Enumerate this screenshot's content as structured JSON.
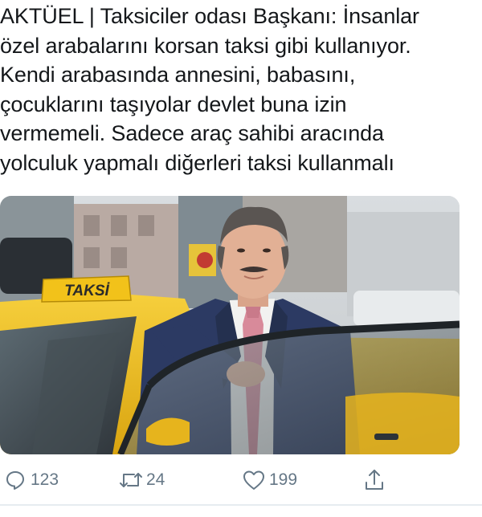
{
  "tweet": {
    "text": "AKTÜEL | Taksiciler odası Başkanı: İnsanlar\nözel arabalarını korsan taksi gibi kullanıyor.\nKendi arabasında annesini, babasını,\nçocuklarını taşıyolar devlet buna izin\nvermemeli. Sadece araç sahibi aracında\nyolculuk yapmalı diğerleri taksi kullanmalı",
    "media": {
      "taxi_sign_text": "TAKSİ"
    }
  },
  "actions": {
    "reply": {
      "icon": "reply-icon",
      "count": "123"
    },
    "retweet": {
      "icon": "retweet-icon",
      "count": "24"
    },
    "like": {
      "icon": "heart-icon",
      "count": "199"
    },
    "share": {
      "icon": "share-icon"
    }
  },
  "colors": {
    "text": "#14171a",
    "icon_gray": "#657786",
    "taxi_yellow": "#f2c21a",
    "suit_navy": "#2c3a63",
    "tie_pink": "#d88a9a"
  }
}
